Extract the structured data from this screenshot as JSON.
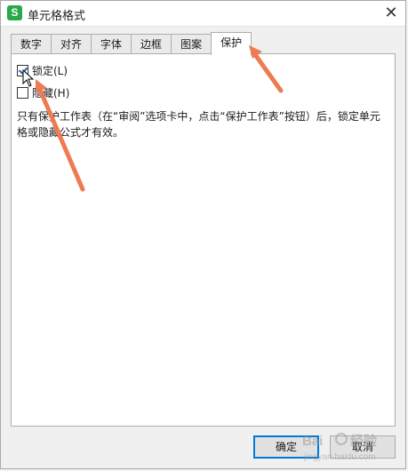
{
  "dialog": {
    "title": "单元格格式",
    "app_icon": "S",
    "close_glyph": "✕"
  },
  "tabs": [
    {
      "label": "数字"
    },
    {
      "label": "对齐"
    },
    {
      "label": "字体"
    },
    {
      "label": "边框"
    },
    {
      "label": "图案"
    },
    {
      "label": "保护",
      "active": true
    }
  ],
  "protection": {
    "locked_label": "锁定(L)",
    "locked_checked": true,
    "hidden_label": "隐藏(H)",
    "hidden_checked": false,
    "description": "只有保护工作表（在“审阅”选项卡中，点击“保护工作表”按钮）后，锁定单元格或隐藏公式才有效。"
  },
  "buttons": {
    "ok_label": "确定",
    "cancel_label": "取消"
  },
  "colors": {
    "arrow": "#ee7b53",
    "accent": "#0078d7",
    "app_icon": "#29a94a"
  }
}
